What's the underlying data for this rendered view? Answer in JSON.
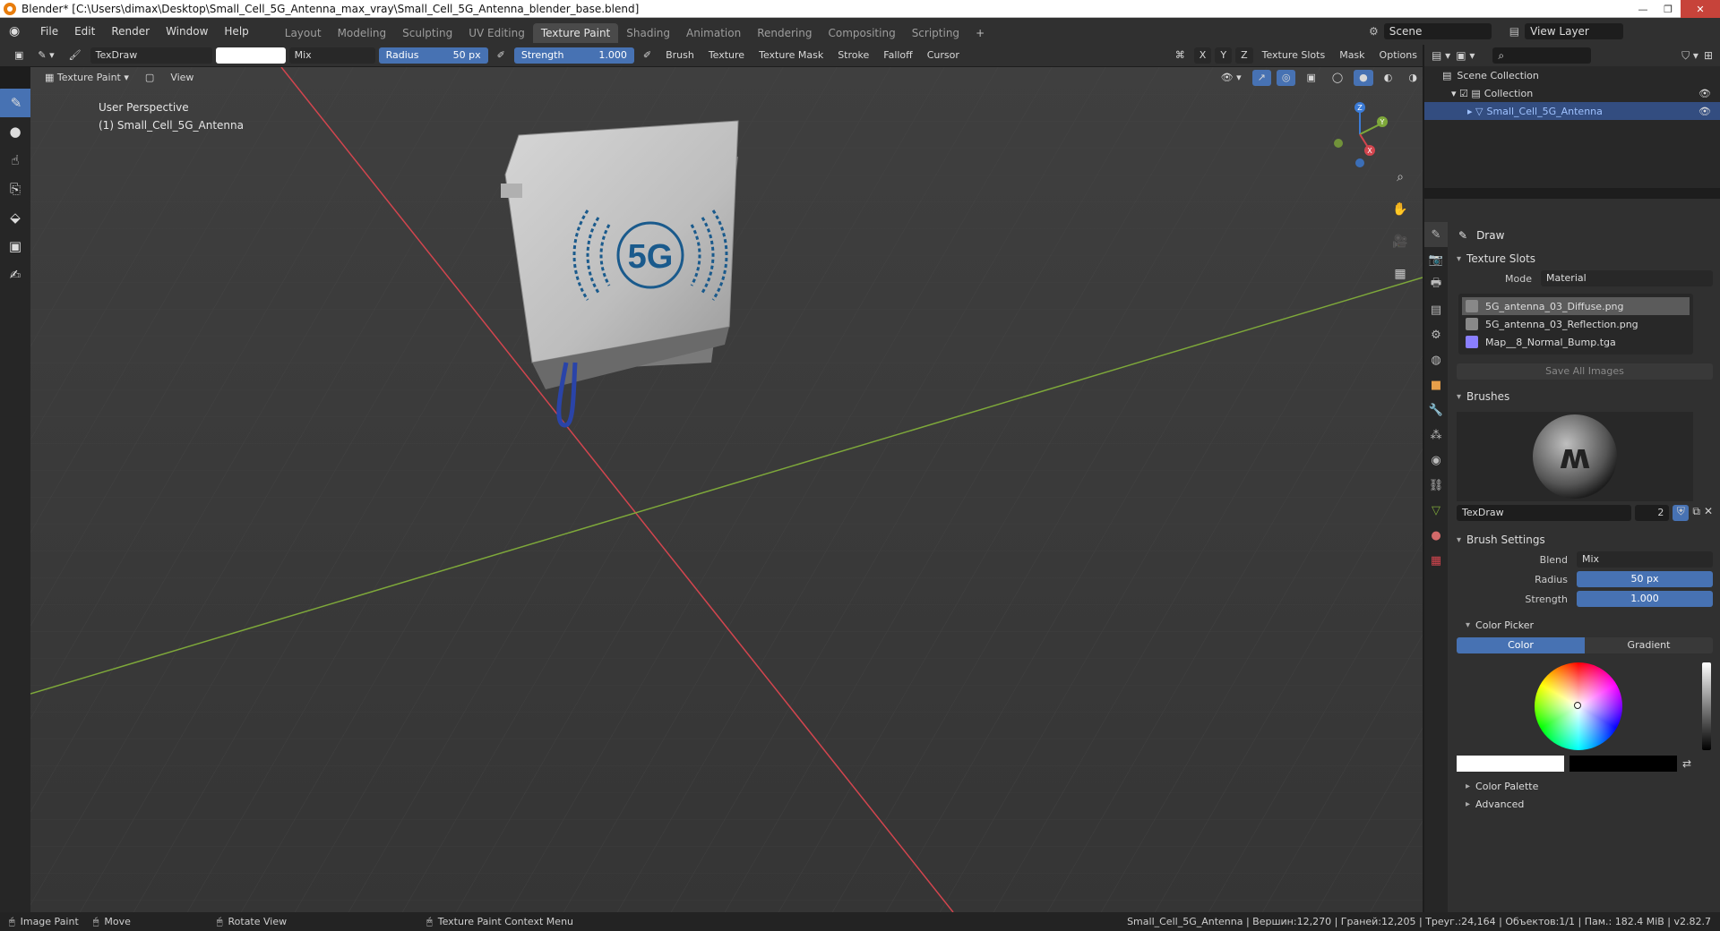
{
  "window": {
    "title": "Blender* [C:\\Users\\dimax\\Desktop\\Small_Cell_5G_Antenna_max_vray\\Small_Cell_5G_Antenna_blender_base.blend]",
    "minimize": "—",
    "maximize": "❐",
    "close": "✕"
  },
  "menu": [
    "File",
    "Edit",
    "Render",
    "Window",
    "Help"
  ],
  "workspaces": [
    "Layout",
    "Modeling",
    "Sculpting",
    "UV Editing",
    "Texture Paint",
    "Shading",
    "Animation",
    "Rendering",
    "Compositing",
    "Scripting",
    "+"
  ],
  "active_workspace": "Texture Paint",
  "scene": {
    "name": "Scene",
    "view_layer": "View Layer"
  },
  "toolheader": {
    "brush_name": "TexDraw",
    "blend": "Mix",
    "radius_label": "Radius",
    "radius_value": "50 px",
    "strength_label": "Strength",
    "strength_value": "1.000",
    "menus": [
      "Brush",
      "Texture",
      "Texture Mask",
      "Stroke",
      "Falloff",
      "Cursor"
    ],
    "axes": [
      "X",
      "Y",
      "Z"
    ],
    "right_menus": [
      "Texture Slots",
      "Mask",
      "Options"
    ]
  },
  "viewheader": {
    "mode": "Texture Paint",
    "view": "View"
  },
  "viewport": {
    "line1": "User Perspective",
    "line2": "(1) Small_Cell_5G_Antenna",
    "logo_text": "5G",
    "gizmo_axes": [
      "Z",
      "Y",
      "X"
    ]
  },
  "outliner": {
    "root": "Scene Collection",
    "collection": "Collection",
    "object": "Small_Cell_5G_Antenna"
  },
  "properties": {
    "tool_title": "Draw",
    "texture_slots_panel": "Texture Slots",
    "mode_label": "Mode",
    "mode_value": "Material",
    "slots": [
      "5G_antenna_03_Diffuse.png",
      "5G_antenna_03_Reflection.png",
      "Map__8_Normal_Bump.tga"
    ],
    "save_all": "Save All Images",
    "brushes_panel": "Brushes",
    "brush_name": "TexDraw",
    "brush_users": "2",
    "brush_settings_panel": "Brush Settings",
    "blend_label": "Blend",
    "blend_value": "Mix",
    "radius_label": "Radius",
    "radius_value": "50 px",
    "strength_label": "Strength",
    "strength_value": "1.000",
    "color_picker": "Color Picker",
    "color_tab": "Color",
    "gradient_tab": "Gradient",
    "color_palette": "Color Palette",
    "advanced": "Advanced"
  },
  "status": {
    "image_paint": "Image Paint",
    "move": "Move",
    "rotate_view": "Rotate View",
    "context_menu": "Texture Paint Context Menu",
    "stats": "Small_Cell_5G_Antenna | Вершин:12,270 | Граней:12,205 | Треуг.:24,164 | Объектов:1/1 | Пам.: 182.4 MiB | v2.82.7"
  },
  "colors": {
    "accent": "#4772b3",
    "x_axis": "#d2454e",
    "y_axis": "#7ea83a",
    "z_axis": "#3b7bd6",
    "logo": "#1a5a8c"
  }
}
